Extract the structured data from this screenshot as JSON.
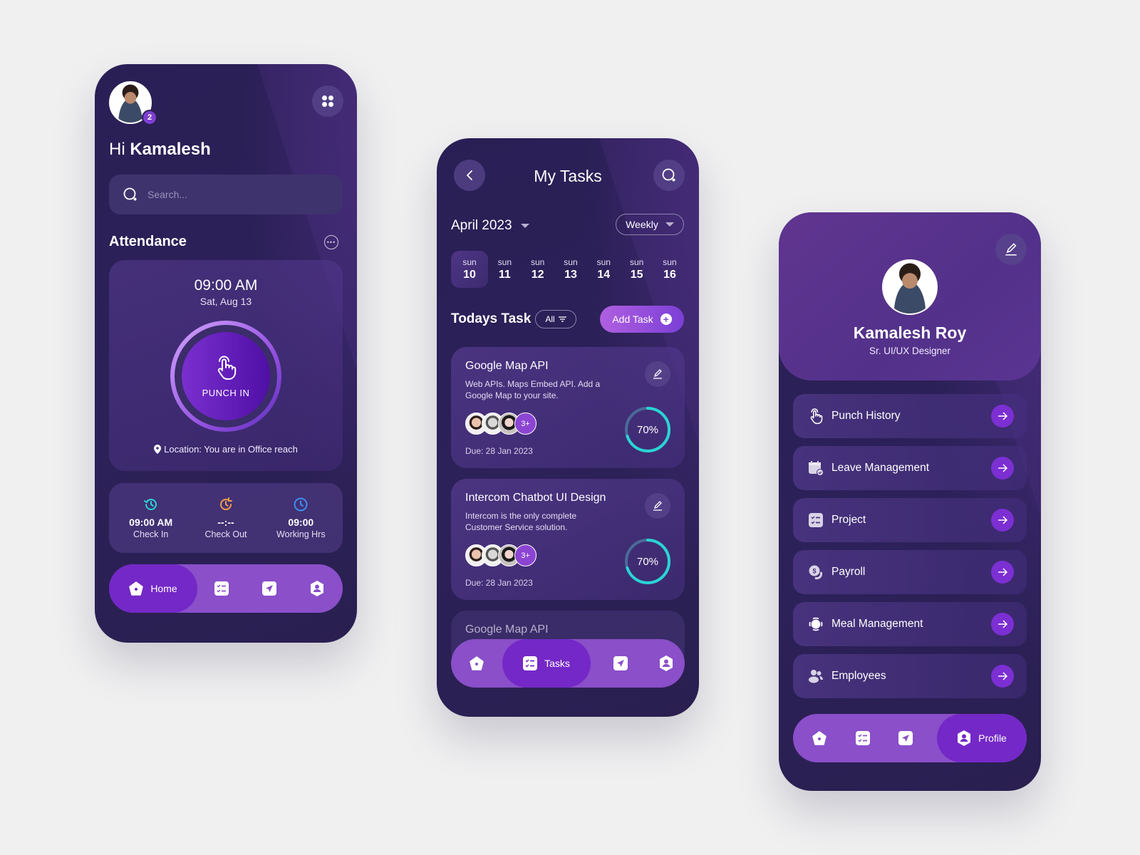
{
  "colors": {
    "background": "#f0f0f1",
    "phone_bg": "#2a1f55",
    "accent": "#7c2fd2",
    "navbar": "#8a4fc9",
    "nav_active": "#7428c7",
    "progress": "#2ad4d4",
    "check_in_icon": "#2ad4d4",
    "check_out_icon": "#f29b4a",
    "working_hrs_icon": "#3d8ef0"
  },
  "home": {
    "notification_count": "2",
    "greeting_prefix": "Hi",
    "greeting_name": "Kamalesh",
    "search_placeholder": "Search...",
    "attendance_title": "Attendance",
    "punch_time": "09:00 AM",
    "punch_date": "Sat, Aug 13",
    "punch_label": "PUNCH IN",
    "location_text": "Location: You are in Office reach",
    "stats": [
      {
        "icon": "history-icon",
        "value": "09:00 AM",
        "label": "Check In"
      },
      {
        "icon": "clock-refresh-icon",
        "value": "--:--",
        "label": "Check Out"
      },
      {
        "icon": "clock-icon",
        "value": "09:00",
        "label": "Working Hrs"
      }
    ],
    "nav": {
      "active_label": "Home"
    }
  },
  "tasks": {
    "title": "My Tasks",
    "month": "April 2023",
    "view": "Weekly",
    "days": [
      {
        "name": "sun",
        "date": "10",
        "active": true
      },
      {
        "name": "sun",
        "date": "11"
      },
      {
        "name": "sun",
        "date": "12"
      },
      {
        "name": "sun",
        "date": "13"
      },
      {
        "name": "sun",
        "date": "14"
      },
      {
        "name": "sun",
        "date": "15"
      },
      {
        "name": "sun",
        "date": "16"
      }
    ],
    "section_title": "Todays Task",
    "filter_label": "All",
    "add_task_label": "Add Task",
    "items": [
      {
        "title": "Google Map API",
        "description": "Web APIs. Maps Embed API. Add a Google Map to your site.",
        "more_members": "3+",
        "due": "Due: 28 Jan 2023",
        "progress": 70,
        "progress_label": "70%"
      },
      {
        "title": "Intercom Chatbot UI Design",
        "description": "Intercom is the only complete Customer Service solution.",
        "more_members": "3+",
        "due": "Due: 28 Jan 2023",
        "progress": 70,
        "progress_label": "70%"
      },
      {
        "title": "Google Map API"
      }
    ],
    "nav": {
      "active_label": "Tasks"
    }
  },
  "profile": {
    "name": "Kamalesh Roy",
    "role": "Sr. UI/UX Designer",
    "menu": [
      {
        "icon": "hand-pointer-icon",
        "label": "Punch History"
      },
      {
        "icon": "calendar-check-icon",
        "label": "Leave Management"
      },
      {
        "icon": "checklist-icon",
        "label": "Project"
      },
      {
        "icon": "coins-icon",
        "label": "Payroll"
      },
      {
        "icon": "plate-icon",
        "label": "Meal Management"
      },
      {
        "icon": "users-icon",
        "label": "Employees"
      }
    ],
    "nav": {
      "active_label": "Profile"
    }
  }
}
